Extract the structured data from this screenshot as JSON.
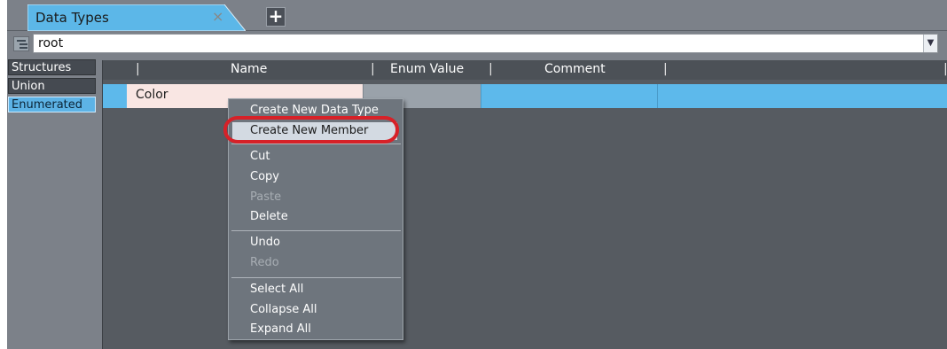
{
  "tabs": [
    {
      "label": "Data Types"
    }
  ],
  "tab_close_glyph": "×",
  "add_tab_glyph": "+",
  "path": {
    "value": "root",
    "dropdown_glyph": "▼"
  },
  "categories": [
    {
      "label": "Structures",
      "selected": false
    },
    {
      "label": "Union",
      "selected": false
    },
    {
      "label": "Enumerated",
      "selected": true
    }
  ],
  "grid": {
    "columns": {
      "name": "Name",
      "enum_value": "Enum Value",
      "comment": "Comment"
    },
    "rows": [
      {
        "name": "Color",
        "enum_value": "",
        "comment": ""
      }
    ]
  },
  "context_menu": {
    "items": [
      {
        "label": "Create New Data Type",
        "enabled": true
      },
      {
        "label": "Create New Member",
        "enabled": true,
        "highlighted": true
      },
      {
        "label": "Cut",
        "enabled": true
      },
      {
        "label": "Copy",
        "enabled": true
      },
      {
        "label": "Paste",
        "enabled": false
      },
      {
        "label": "Delete",
        "enabled": true
      },
      {
        "label": "Undo",
        "enabled": true
      },
      {
        "label": "Redo",
        "enabled": false
      },
      {
        "label": "Select All",
        "enabled": true
      },
      {
        "label": "Collapse All",
        "enabled": true
      },
      {
        "label": "Expand All",
        "enabled": true
      }
    ]
  },
  "colors": {
    "frame": "#7c8189",
    "selection": "#5db9eb",
    "highlight_ring": "#d72128"
  }
}
